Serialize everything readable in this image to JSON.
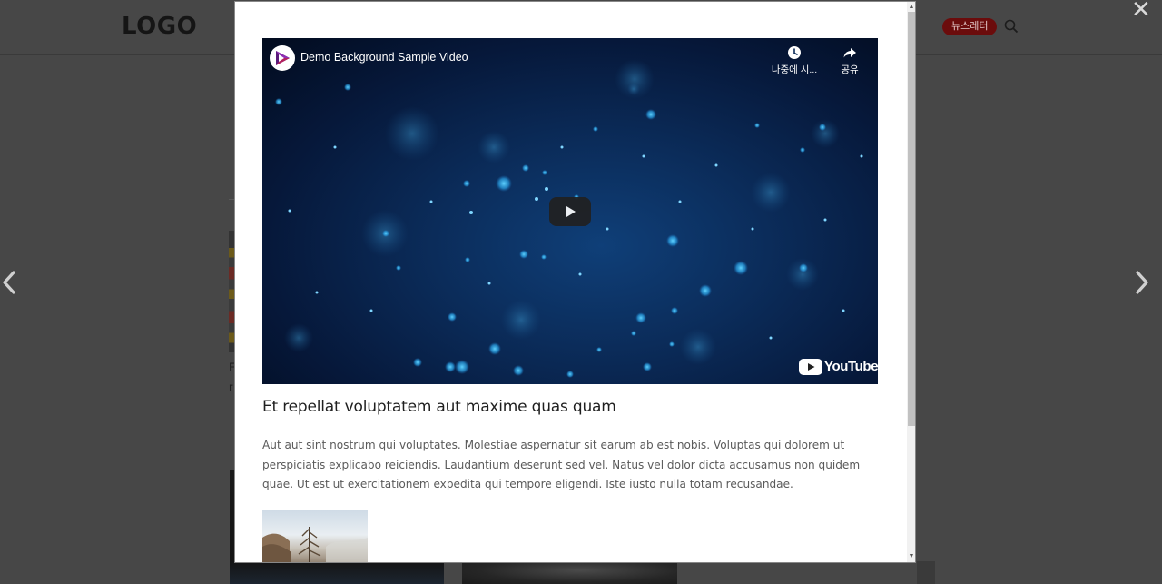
{
  "header": {
    "logo_text": "LOGO",
    "newsletter_label": "뉴스레터",
    "search_icon": "search-icon"
  },
  "background": {
    "text_b": "E",
    "text_r": "r"
  },
  "lightbox": {
    "close_icon": "close-icon",
    "prev_icon": "chevron-left-icon",
    "next_icon": "chevron-right-icon"
  },
  "video": {
    "title": "Demo Background Sample Video",
    "watch_later_label": "나중에 시...",
    "share_label": "공유",
    "brand_label": "YouTube",
    "play_icon": "play-icon"
  },
  "article": {
    "title": "Et repellat voluptatem aut maxime quas quam",
    "body": "Aut aut sint nostrum qui voluptates. Molestiae aspernatur sit earum ab est nobis. Voluptas qui dolorem ut perspiciatis explicabo reiciendis. Laudantium deserunt sed vel. Natus vel dolor dicta accusamus non quidem quae. Ut est ut exercitationem expedita qui tempore eligendi. Iste iusto nulla totam recusandae."
  },
  "colors": {
    "overlay": "#474747",
    "newsletter_bg": "#6b0c0c",
    "modal_bg": "#ffffff",
    "video_bg": "#0b2c5a"
  }
}
